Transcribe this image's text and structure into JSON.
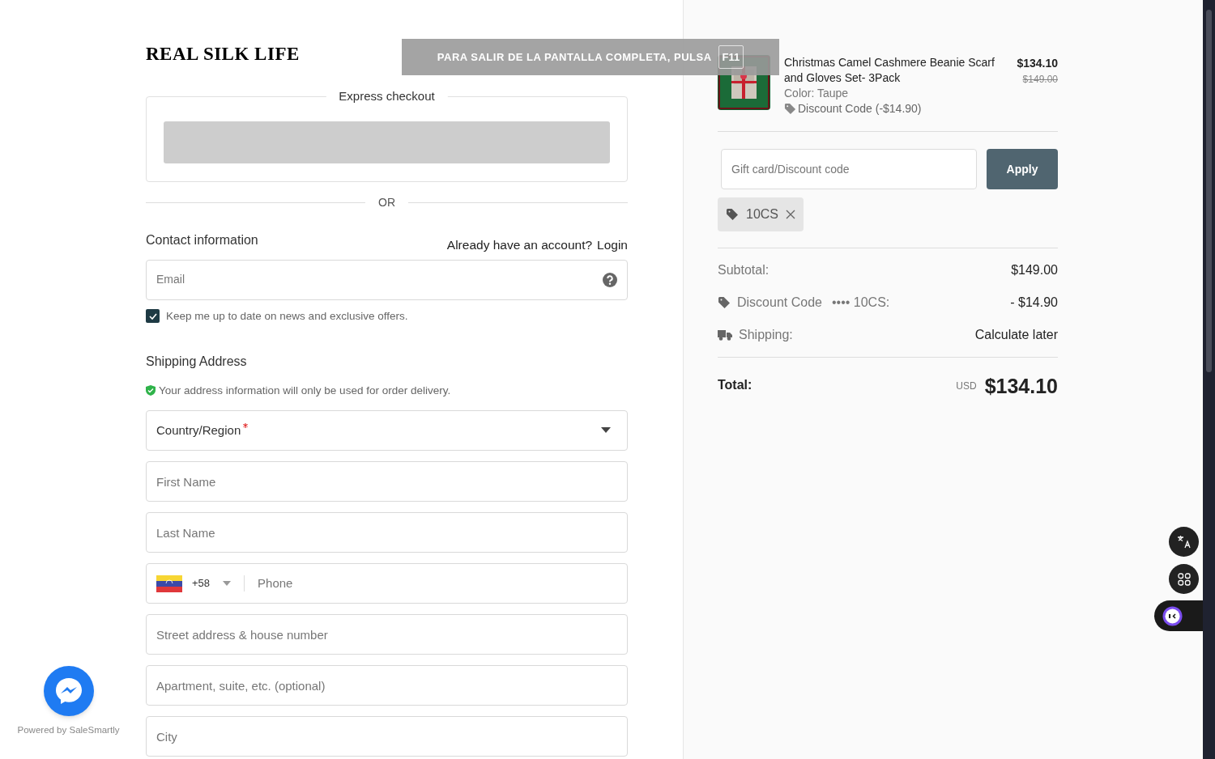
{
  "logo": "REAL SILK LIFE",
  "fullscreen_notice": {
    "text": "PARA SALIR DE LA PANTALLA COMPLETA, PULSA",
    "key": "F11"
  },
  "express_checkout": {
    "title": "Express checkout"
  },
  "divider": "OR",
  "contact": {
    "title": "Contact information",
    "account_prompt": "Already have an account?",
    "login": "Login",
    "email_placeholder": "Email",
    "newsletter": {
      "label": "Keep me up to date on news and exclusive offers.",
      "checked": true
    }
  },
  "shipping": {
    "title": "Shipping Address",
    "notice": "Your address information will only be used for order delivery.",
    "fields": [
      {
        "kind": "select",
        "placeholder": "Country/Region",
        "required": true
      },
      {
        "kind": "text",
        "placeholder": "First Name"
      },
      {
        "kind": "text",
        "placeholder": "Last Name"
      },
      {
        "kind": "phone",
        "dial_code": "+58",
        "placeholder": "Phone"
      },
      {
        "kind": "text",
        "placeholder": "Street address & house number"
      },
      {
        "kind": "text",
        "placeholder": "Apartment, suite, etc. (optional)"
      },
      {
        "kind": "text",
        "placeholder": "City"
      }
    ]
  },
  "chat_widget": {
    "powered_by": "Powered by SaleSmartly"
  },
  "order": {
    "item": {
      "name": "Christmas Camel Cashmere Beanie Scarf and Gloves Set- 3Pack",
      "variant": "Color: Taupe",
      "discount": "Discount Code (-$14.90)",
      "price": "$134.10",
      "original_price": "$149.00"
    },
    "discount_field": {
      "placeholder": "Gift card/Discount code",
      "button": "Apply"
    },
    "applied_code": "10CS",
    "summary": [
      {
        "kind": "subtotal",
        "label": "Subtotal:",
        "value": "$149.00"
      },
      {
        "kind": "discount",
        "label": "Discount Code",
        "code": "•••• 10CS:",
        "value": "- $14.90"
      },
      {
        "kind": "shipping",
        "label": "Shipping:",
        "value": "Calculate later"
      }
    ],
    "total": {
      "label": "Total:",
      "currency": "USD",
      "value": "$134.10"
    }
  }
}
